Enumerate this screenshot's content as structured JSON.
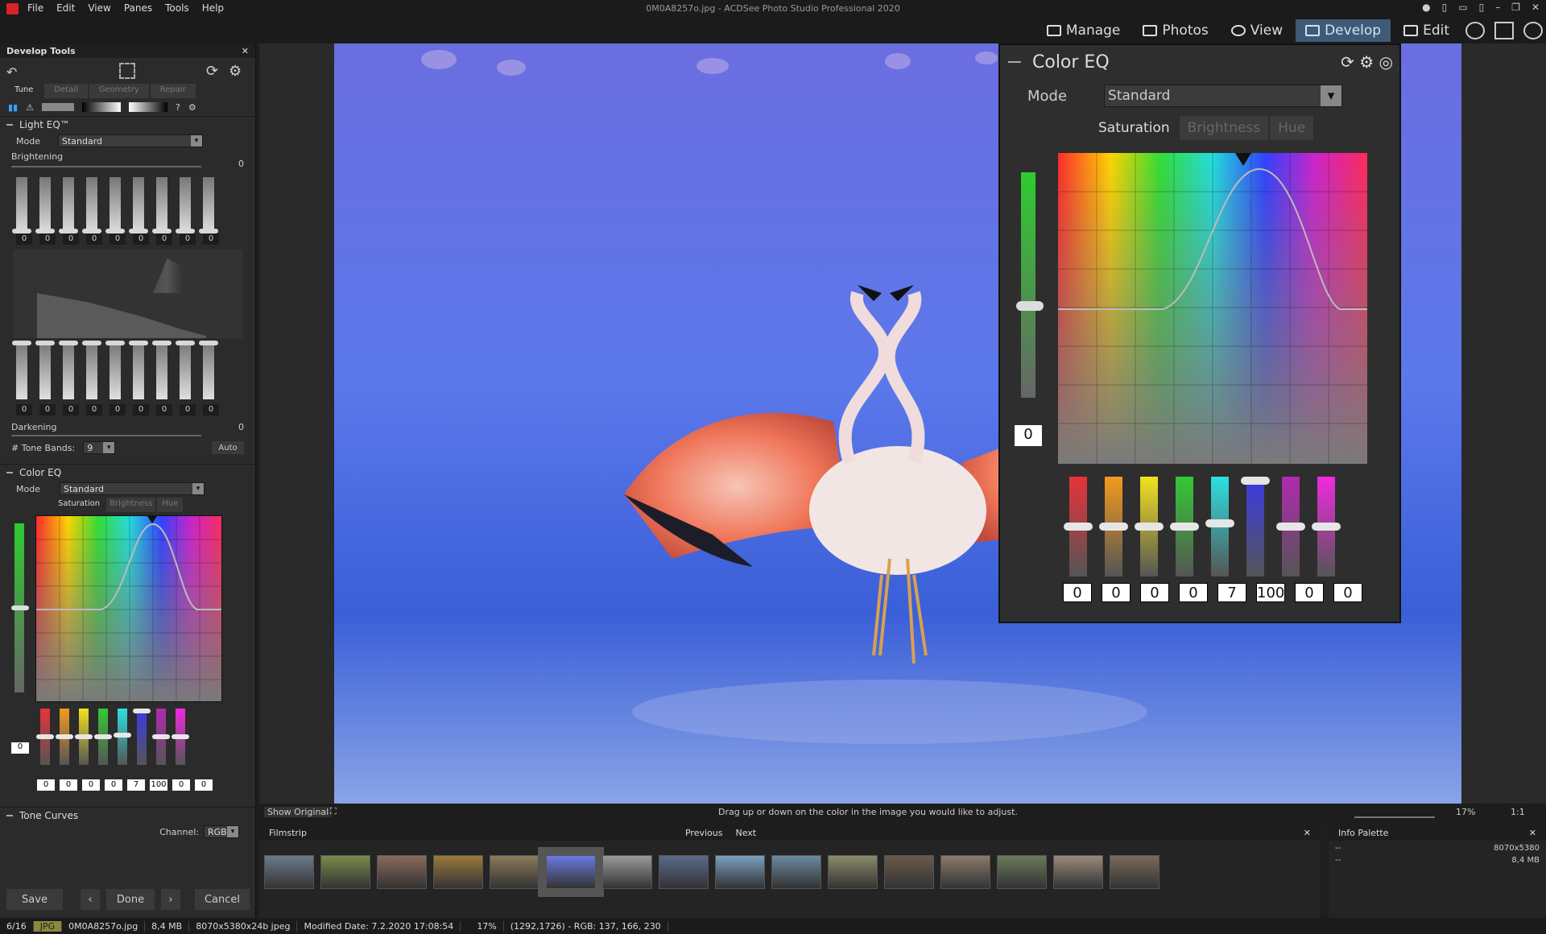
{
  "title": {
    "menu": [
      "File",
      "Edit",
      "View",
      "Panes",
      "Tools",
      "Help"
    ],
    "window_title": "0M0A8257o.jpg - ACDSee Photo Studio Professional 2020"
  },
  "modes": {
    "items": [
      "Manage",
      "Photos",
      "View",
      "Develop",
      "Edit"
    ],
    "active": "Develop"
  },
  "left_panel": {
    "title": "Develop Tools",
    "tabs": [
      "Tune",
      "Detail",
      "Geometry",
      "Repair"
    ],
    "active_tab": "Tune",
    "light_eq": {
      "title": "Light EQ™",
      "mode_label": "Mode",
      "mode_value": "Standard",
      "brightening_label": "Brightening",
      "brightening_value": "0",
      "brighten_bands": [
        "0",
        "0",
        "0",
        "0",
        "0",
        "0",
        "0",
        "0",
        "0"
      ],
      "darken_bands": [
        "0",
        "0",
        "0",
        "0",
        "0",
        "0",
        "0",
        "0",
        "0"
      ],
      "darkening_label": "Darkening",
      "darkening_value": "0",
      "tone_bands_label": "# Tone Bands:",
      "tone_bands_value": "9",
      "auto_label": "Auto"
    },
    "color_eq": {
      "title": "Color EQ",
      "mode_label": "Mode",
      "mode_value": "Standard",
      "tabs": [
        "Saturation",
        "Brightness",
        "Hue"
      ],
      "side_value": "0",
      "values": [
        "0",
        "0",
        "0",
        "0",
        "7",
        "100",
        "0",
        "0"
      ]
    },
    "tone_curves": {
      "title": "Tone Curves",
      "channel_label": "Channel:",
      "channel_value": "RGB"
    },
    "buttons": {
      "save": "Save",
      "done": "Done",
      "cancel": "Cancel"
    }
  },
  "floating_color_eq": {
    "title": "Color EQ",
    "mode_label": "Mode",
    "mode_value": "Standard",
    "tabs": [
      "Saturation",
      "Brightness",
      "Hue"
    ],
    "active_tab": "Saturation",
    "side_value": "0",
    "values": [
      "0",
      "0",
      "0",
      "0",
      "7",
      "100",
      "0",
      "0"
    ],
    "slider_colors": [
      "#e8323a",
      "#f39a1e",
      "#f3e21e",
      "#34c934",
      "#2ee0e0",
      "#3a3ae8",
      "#b02ab0",
      "#f02ae0"
    ]
  },
  "viewer": {
    "show_original": "Show Original",
    "hint": "Drag up or down on the color in the image you would like to adjust.",
    "zoom": "17%",
    "one_to_one": "1:1"
  },
  "filmstrip": {
    "title": "Filmstrip",
    "previous": "Previous",
    "next": "Next",
    "thumb_count": 16,
    "selected_index": 5
  },
  "info_palette": {
    "title": "Info Palette",
    "dims": "8070x5380",
    "size": "8,4 MB",
    "dashes": "--"
  },
  "status": {
    "index": "6/16",
    "format": "JPG",
    "filename": "0M0A8257o.jpg",
    "filesize": "8,4 MB",
    "dimensions": "8070x5380x24b jpeg",
    "modified": "Modified Date: 7.2.2020 17:08:54",
    "zoom": "17%",
    "pixel": "(1292,1726) - RGB: 137, 166, 230"
  }
}
